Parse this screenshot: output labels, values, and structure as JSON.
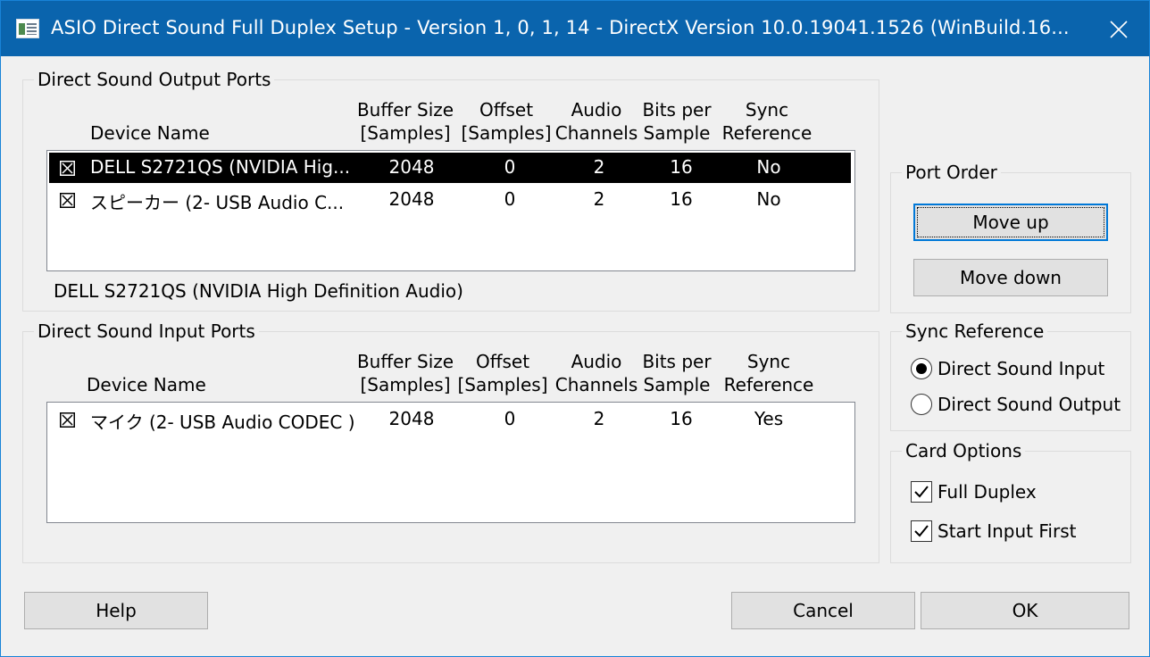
{
  "window": {
    "title": "ASIO Direct Sound Full Duplex Setup  -  Version 1, 0, 1, 14  -  DirectX Version 10.0.19041.1526 (WinBuild.16...",
    "app_icon": "app-window-icon",
    "close_icon": "close-icon"
  },
  "output_ports": {
    "title": "Direct Sound Output Ports",
    "columns": {
      "device_name": "Device Name",
      "buffer_1": "Buffer Size",
      "buffer_2": "[Samples]",
      "offset_1": "Offset",
      "offset_2": "[Samples]",
      "channels_1": "Audio",
      "channels_2": "Channels",
      "bits_1": "Bits per",
      "bits_2": "Sample",
      "sync_1": "Sync",
      "sync_2": "Reference"
    },
    "rows": [
      {
        "checked": true,
        "name": "DELL S2721QS (NVIDIA Hig...",
        "buffer": "2048",
        "offset": "0",
        "channels": "2",
        "bits": "16",
        "sync": "No"
      },
      {
        "checked": true,
        "name": "スピーカー (2- USB Audio C...",
        "buffer": "2048",
        "offset": "0",
        "channels": "2",
        "bits": "16",
        "sync": "No"
      }
    ],
    "selected_device": "DELL S2721QS (NVIDIA High Definition Audio)"
  },
  "input_ports": {
    "title": "Direct Sound Input Ports",
    "columns": {
      "device_name": "Device Name",
      "buffer_1": "Buffer Size",
      "buffer_2": "[Samples]",
      "offset_1": "Offset",
      "offset_2": "[Samples]",
      "channels_1": "Audio",
      "channels_2": "Channels",
      "bits_1": "Bits per",
      "bits_2": "Sample",
      "sync_1": "Sync",
      "sync_2": "Reference"
    },
    "rows": [
      {
        "checked": true,
        "name": "マイク (2- USB Audio CODEC )",
        "buffer": "2048",
        "offset": "0",
        "channels": "2",
        "bits": "16",
        "sync": "Yes"
      }
    ]
  },
  "port_order": {
    "title": "Port Order",
    "move_up": "Move up",
    "move_down": "Move down"
  },
  "sync_reference": {
    "title": "Sync Reference",
    "options": [
      {
        "label": "Direct Sound Input",
        "selected": true
      },
      {
        "label": "Direct Sound Output",
        "selected": false
      }
    ]
  },
  "card_options": {
    "title": "Card Options",
    "options": [
      {
        "label": "Full Duplex",
        "checked": true
      },
      {
        "label": "Start Input First",
        "checked": true
      }
    ]
  },
  "buttons": {
    "help": "Help",
    "cancel": "Cancel",
    "ok": "OK"
  }
}
